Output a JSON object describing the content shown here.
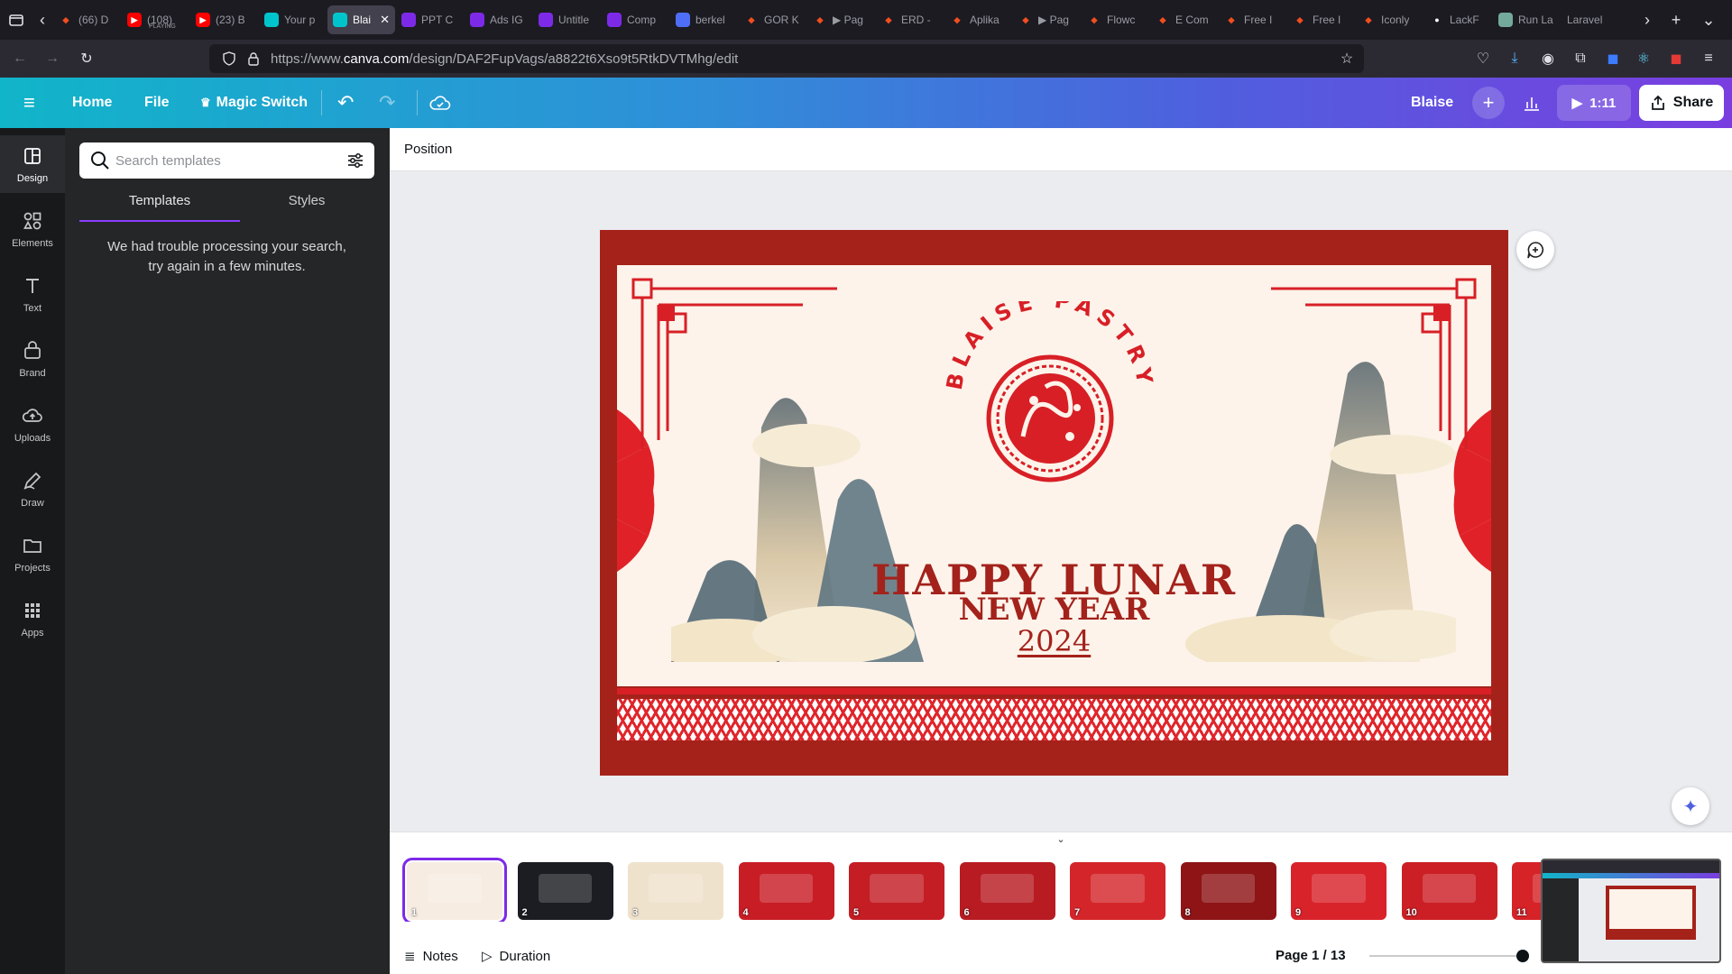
{
  "browser": {
    "tabs": [
      {
        "label": "(66) D",
        "icon": "figma-icon",
        "color": "#e44d26"
      },
      {
        "label": "(108)",
        "sublabel": "PLAYING",
        "icon": "youtube-icon",
        "color": "#ff0000"
      },
      {
        "label": "(23) B",
        "icon": "youtube-icon",
        "color": "#ff0000"
      },
      {
        "label": "Your p",
        "icon": "canva-icon",
        "color": "#00c4cc"
      },
      {
        "label": "Blai",
        "icon": "canva-icon",
        "color": "#00c4cc",
        "active": true
      },
      {
        "label": "PPT C",
        "icon": "canva-icon",
        "color": "#7d2ae8"
      },
      {
        "label": "Ads IG",
        "icon": "canva-icon",
        "color": "#7d2ae8"
      },
      {
        "label": "Untitle",
        "icon": "canva-icon",
        "color": "#7d2ae8"
      },
      {
        "label": "Comp",
        "icon": "canva-icon",
        "color": "#7d2ae8"
      },
      {
        "label": "berkel",
        "icon": "doc-icon",
        "color": "#4f6ef7"
      },
      {
        "label": "GOR K",
        "icon": "figma-icon",
        "color": "#1e1e1e"
      },
      {
        "label": "▶ Pag",
        "icon": "figma-icon",
        "color": "#1e1e1e"
      },
      {
        "label": "ERD -",
        "icon": "figma-icon",
        "color": "#1e1e1e"
      },
      {
        "label": "Aplika",
        "icon": "figma-icon",
        "color": "#1e1e1e"
      },
      {
        "label": "▶ Pag",
        "icon": "figma-icon",
        "color": "#1e1e1e"
      },
      {
        "label": "Flowc",
        "icon": "figma-icon",
        "color": "#1e1e1e"
      },
      {
        "label": "E Com",
        "icon": "figma-icon",
        "color": "#1e1e1e"
      },
      {
        "label": "Free I",
        "icon": "figma-icon",
        "color": "#1e1e1e"
      },
      {
        "label": "Free I",
        "icon": "figma-icon",
        "color": "#1e1e1e"
      },
      {
        "label": "Iconly",
        "icon": "figma-icon",
        "color": "#1e1e1e"
      },
      {
        "label": "LackF",
        "icon": "github-icon",
        "color": "#ffffff"
      },
      {
        "label": "Run La",
        "icon": "openai-icon",
        "color": "#74aa9c"
      },
      {
        "label": "Laravel",
        "icon": "",
        "color": ""
      }
    ],
    "url_prefix": "https://www.",
    "url_domain": "canva.com",
    "url_path": "/design/DAF2FupVags/a8822t6Xso9t5RtkDVTMhg/edit"
  },
  "header": {
    "home": "Home",
    "file": "File",
    "magic_switch": "Magic Switch",
    "user": "Blaise",
    "present_time": "1:11",
    "share": "Share"
  },
  "rail": [
    {
      "label": "Design",
      "icon": "design-icon",
      "active": true
    },
    {
      "label": "Elements",
      "icon": "elements-icon"
    },
    {
      "label": "Text",
      "icon": "text-icon"
    },
    {
      "label": "Brand",
      "icon": "brand-icon"
    },
    {
      "label": "Uploads",
      "icon": "uploads-icon"
    },
    {
      "label": "Draw",
      "icon": "draw-icon"
    },
    {
      "label": "Projects",
      "icon": "projects-icon"
    },
    {
      "label": "Apps",
      "icon": "apps-icon"
    }
  ],
  "panel": {
    "search_placeholder": "Search templates",
    "tab_templates": "Templates",
    "tab_styles": "Styles",
    "error_line1": "We had trouble processing your search,",
    "error_line2": "try again in a few minutes."
  },
  "toolbar": {
    "position": "Position"
  },
  "design": {
    "brand_arc": "BLAISE PASTRY",
    "line1": "HAPPY LUNAR",
    "line2": "NEW YEAR",
    "year": "2024",
    "colors": {
      "frame": "#a5221a",
      "cream": "#fdf3ea",
      "red": "#d81f26",
      "text": "#a3221b"
    }
  },
  "pages": {
    "thumbs": [
      {
        "n": "1",
        "bg": "#f7ece2",
        "selected": true
      },
      {
        "n": "2",
        "bg": "#1b1d22"
      },
      {
        "n": "3",
        "bg": "#efe2cc"
      },
      {
        "n": "4",
        "bg": "#c81d25"
      },
      {
        "n": "5",
        "bg": "#c41d24"
      },
      {
        "n": "6",
        "bg": "#b81b22"
      },
      {
        "n": "7",
        "bg": "#d4262a"
      },
      {
        "n": "8",
        "bg": "#8e1416"
      },
      {
        "n": "9",
        "bg": "#d8232a"
      },
      {
        "n": "10",
        "bg": "#cc1f25"
      },
      {
        "n": "11",
        "bg": "#d52328"
      }
    ],
    "notes": "Notes",
    "duration": "Duration",
    "page_indicator": "Page 1 / 13"
  }
}
